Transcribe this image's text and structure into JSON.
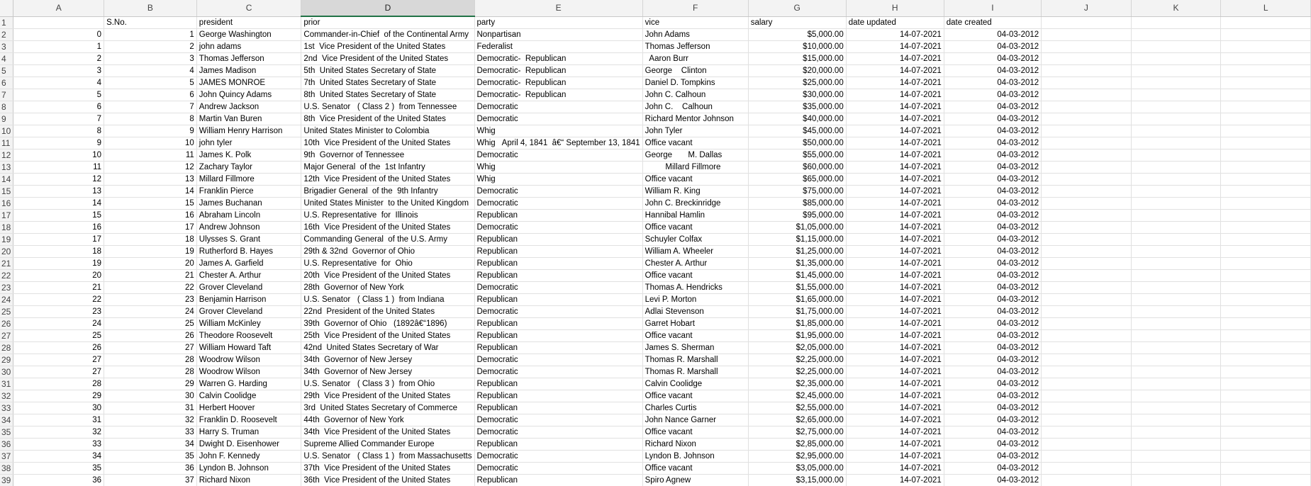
{
  "colors": {
    "header_bg": "#f3f3f3",
    "selected_header_bg": "#d8d8d8",
    "selected_accent": "#217346",
    "gridline": "#e1e1e1"
  },
  "sheet": {
    "selected_column": "D",
    "column_headers": [
      "A",
      "B",
      "C",
      "D",
      "E",
      "F",
      "G",
      "H",
      "I",
      "J",
      "K",
      "L"
    ],
    "header_row": [
      "",
      "S.No.",
      "president",
      "prior",
      "party",
      "vice",
      "salary",
      "date updated",
      "date created"
    ],
    "rows": [
      [
        "0",
        "1",
        "George Washington",
        "Commander-in-Chief  of the Continental Army",
        "Nonpartisan",
        "John Adams",
        "$5,000.00",
        "14-07-2021",
        "04-03-2012"
      ],
      [
        "1",
        "2",
        "john adams",
        "1st  Vice President of the United States",
        "Federalist",
        "Thomas Jefferson",
        "$10,000.00",
        "14-07-2021",
        "04-03-2012"
      ],
      [
        "2",
        "3",
        "Thomas Jefferson",
        "2nd  Vice President of the United States",
        "Democratic-  Republican",
        "  Aaron Burr",
        "$15,000.00",
        "14-07-2021",
        "04-03-2012"
      ],
      [
        "3",
        "4",
        "James Madison",
        "5th  United States Secretary of State",
        "Democratic-  Republican",
        "George    Clinton",
        "$20,000.00",
        "14-07-2021",
        "04-03-2012"
      ],
      [
        "4",
        "5",
        "JAMES MONROE",
        "7th  United States Secretary of State",
        "Democratic-  Republican",
        "Daniel D. Tompkins",
        "$25,000.00",
        "14-07-2021",
        "04-03-2012"
      ],
      [
        "5",
        "6",
        "John Quincy Adams",
        "8th  United States Secretary of State",
        "Democratic-  Republican",
        "John C. Calhoun",
        "$30,000.00",
        "14-07-2021",
        "04-03-2012"
      ],
      [
        "6",
        "7",
        "Andrew Jackson",
        "U.S. Senator   ( Class 2 )  from Tennessee",
        "Democratic",
        "John C.    Calhoun",
        "$35,000.00",
        "14-07-2021",
        "04-03-2012"
      ],
      [
        "7",
        "8",
        "Martin Van Buren",
        "8th  Vice President of the United States",
        "Democratic",
        "Richard Mentor Johnson",
        "$40,000.00",
        "14-07-2021",
        "04-03-2012"
      ],
      [
        "8",
        "9",
        "William Henry Harrison",
        "United States Minister to Colombia",
        "Whig",
        "John Tyler",
        "$45,000.00",
        "14-07-2021",
        "04-03-2012"
      ],
      [
        "9",
        "10",
        "john tyler",
        "10th  Vice President of the United States",
        "Whig   April 4, 1841  â€“ September 13, 1841",
        "Office vacant",
        "$50,000.00",
        "14-07-2021",
        "04-03-2012"
      ],
      [
        "10",
        "11",
        "James K. Polk",
        "9th  Governor of Tennessee",
        "Democratic",
        "George       M. Dallas",
        "$55,000.00",
        "14-07-2021",
        "04-03-2012"
      ],
      [
        "11",
        "12",
        "Zachary Taylor",
        "Major General  of the  1st Infantry",
        "Whig",
        "         Millard Fillmore",
        "$60,000.00",
        "14-07-2021",
        "04-03-2012"
      ],
      [
        "12",
        "13",
        "Millard Fillmore",
        "12th  Vice President of the United States",
        "Whig",
        "Office vacant",
        "$65,000.00",
        "14-07-2021",
        "04-03-2012"
      ],
      [
        "13",
        "14",
        "Franklin Pierce",
        "Brigadier General  of the  9th Infantry",
        "Democratic",
        "William R. King",
        "$75,000.00",
        "14-07-2021",
        "04-03-2012"
      ],
      [
        "14",
        "15",
        "James Buchanan",
        "United States Minister  to the United Kingdom",
        "Democratic",
        "John C. Breckinridge",
        "$85,000.00",
        "14-07-2021",
        "04-03-2012"
      ],
      [
        "15",
        "16",
        "Abraham Lincoln",
        "U.S. Representative  for  Illinois",
        "Republican",
        "Hannibal Hamlin",
        "$95,000.00",
        "14-07-2021",
        "04-03-2012"
      ],
      [
        "16",
        "17",
        "Andrew Johnson",
        "16th  Vice President of the United States",
        "Democratic",
        "Office vacant",
        "$1,05,000.00",
        "14-07-2021",
        "04-03-2012"
      ],
      [
        "17",
        "18",
        "Ulysses S. Grant",
        "Commanding General  of the U.S. Army",
        "Republican",
        "Schuyler Colfax",
        "$1,15,000.00",
        "14-07-2021",
        "04-03-2012"
      ],
      [
        "18",
        "19",
        "Rutherford B. Hayes",
        "29th & 32nd  Governor of Ohio",
        "Republican",
        "William A. Wheeler",
        "$1,25,000.00",
        "14-07-2021",
        "04-03-2012"
      ],
      [
        "19",
        "20",
        "James A. Garfield",
        "U.S. Representative  for  Ohio",
        "Republican",
        "Chester A. Arthur",
        "$1,35,000.00",
        "14-07-2021",
        "04-03-2012"
      ],
      [
        "20",
        "21",
        "Chester A. Arthur",
        "20th  Vice President of the United States",
        "Republican",
        "Office vacant",
        "$1,45,000.00",
        "14-07-2021",
        "04-03-2012"
      ],
      [
        "21",
        "22",
        "Grover Cleveland",
        "28th  Governor of New York",
        "Democratic",
        "Thomas A. Hendricks",
        "$1,55,000.00",
        "14-07-2021",
        "04-03-2012"
      ],
      [
        "22",
        "23",
        "Benjamin Harrison",
        "U.S. Senator   ( Class 1 )  from Indiana",
        "Republican",
        "Levi P. Morton",
        "$1,65,000.00",
        "14-07-2021",
        "04-03-2012"
      ],
      [
        "23",
        "24",
        "Grover Cleveland",
        "22nd  President of the United States",
        "Democratic",
        "Adlai Stevenson",
        "$1,75,000.00",
        "14-07-2021",
        "04-03-2012"
      ],
      [
        "24",
        "25",
        "William McKinley",
        "39th  Governor of Ohio   (1892â€“1896)",
        "Republican",
        "Garret Hobart",
        "$1,85,000.00",
        "14-07-2021",
        "04-03-2012"
      ],
      [
        "25",
        "26",
        "Theodore Roosevelt",
        "25th  Vice President of the United States",
        "Republican",
        "Office vacant",
        "$1,95,000.00",
        "14-07-2021",
        "04-03-2012"
      ],
      [
        "26",
        "27",
        "William Howard Taft",
        "42nd  United States Secretary of War",
        "Republican",
        "James S. Sherman",
        "$2,05,000.00",
        "14-07-2021",
        "04-03-2012"
      ],
      [
        "27",
        "28",
        "Woodrow Wilson",
        "34th  Governor of New Jersey",
        "Democratic",
        "Thomas R. Marshall",
        "$2,25,000.00",
        "14-07-2021",
        "04-03-2012"
      ],
      [
        "27",
        "28",
        "Woodrow Wilson",
        "34th  Governor of New Jersey",
        "Democratic",
        "Thomas R. Marshall",
        "$2,25,000.00",
        "14-07-2021",
        "04-03-2012"
      ],
      [
        "28",
        "29",
        "Warren G. Harding",
        "U.S. Senator   ( Class 3 )  from Ohio",
        "Republican",
        "Calvin Coolidge",
        "$2,35,000.00",
        "14-07-2021",
        "04-03-2012"
      ],
      [
        "29",
        "30",
        "Calvin Coolidge",
        "29th  Vice President of the United States",
        "Republican",
        "Office vacant",
        "$2,45,000.00",
        "14-07-2021",
        "04-03-2012"
      ],
      [
        "30",
        "31",
        "Herbert Hoover",
        "3rd  United States Secretary of Commerce",
        "Republican",
        "Charles Curtis",
        "$2,55,000.00",
        "14-07-2021",
        "04-03-2012"
      ],
      [
        "31",
        "32",
        "Franklin D. Roosevelt",
        "44th  Governor of New York",
        "Democratic",
        "John Nance Garner",
        "$2,65,000.00",
        "14-07-2021",
        "04-03-2012"
      ],
      [
        "32",
        "33",
        "Harry S. Truman",
        "34th  Vice President of the United States",
        "Democratic",
        "Office vacant",
        "$2,75,000.00",
        "14-07-2021",
        "04-03-2012"
      ],
      [
        "33",
        "34",
        "Dwight D. Eisenhower",
        "Supreme Allied Commander Europe",
        "Republican",
        "Richard Nixon",
        "$2,85,000.00",
        "14-07-2021",
        "04-03-2012"
      ],
      [
        "34",
        "35",
        "John F. Kennedy",
        "U.S. Senator   ( Class 1 )  from Massachusetts",
        "Democratic",
        "Lyndon B. Johnson",
        "$2,95,000.00",
        "14-07-2021",
        "04-03-2012"
      ],
      [
        "35",
        "36",
        "Lyndon B. Johnson",
        "37th  Vice President of the United States",
        "Democratic",
        "Office vacant",
        "$3,05,000.00",
        "14-07-2021",
        "04-03-2012"
      ],
      [
        "36",
        "37",
        "Richard Nixon",
        "36th  Vice President of the United States",
        "Republican",
        "Spiro Agnew",
        "$3,15,000.00",
        "14-07-2021",
        "04-03-2012"
      ]
    ]
  }
}
